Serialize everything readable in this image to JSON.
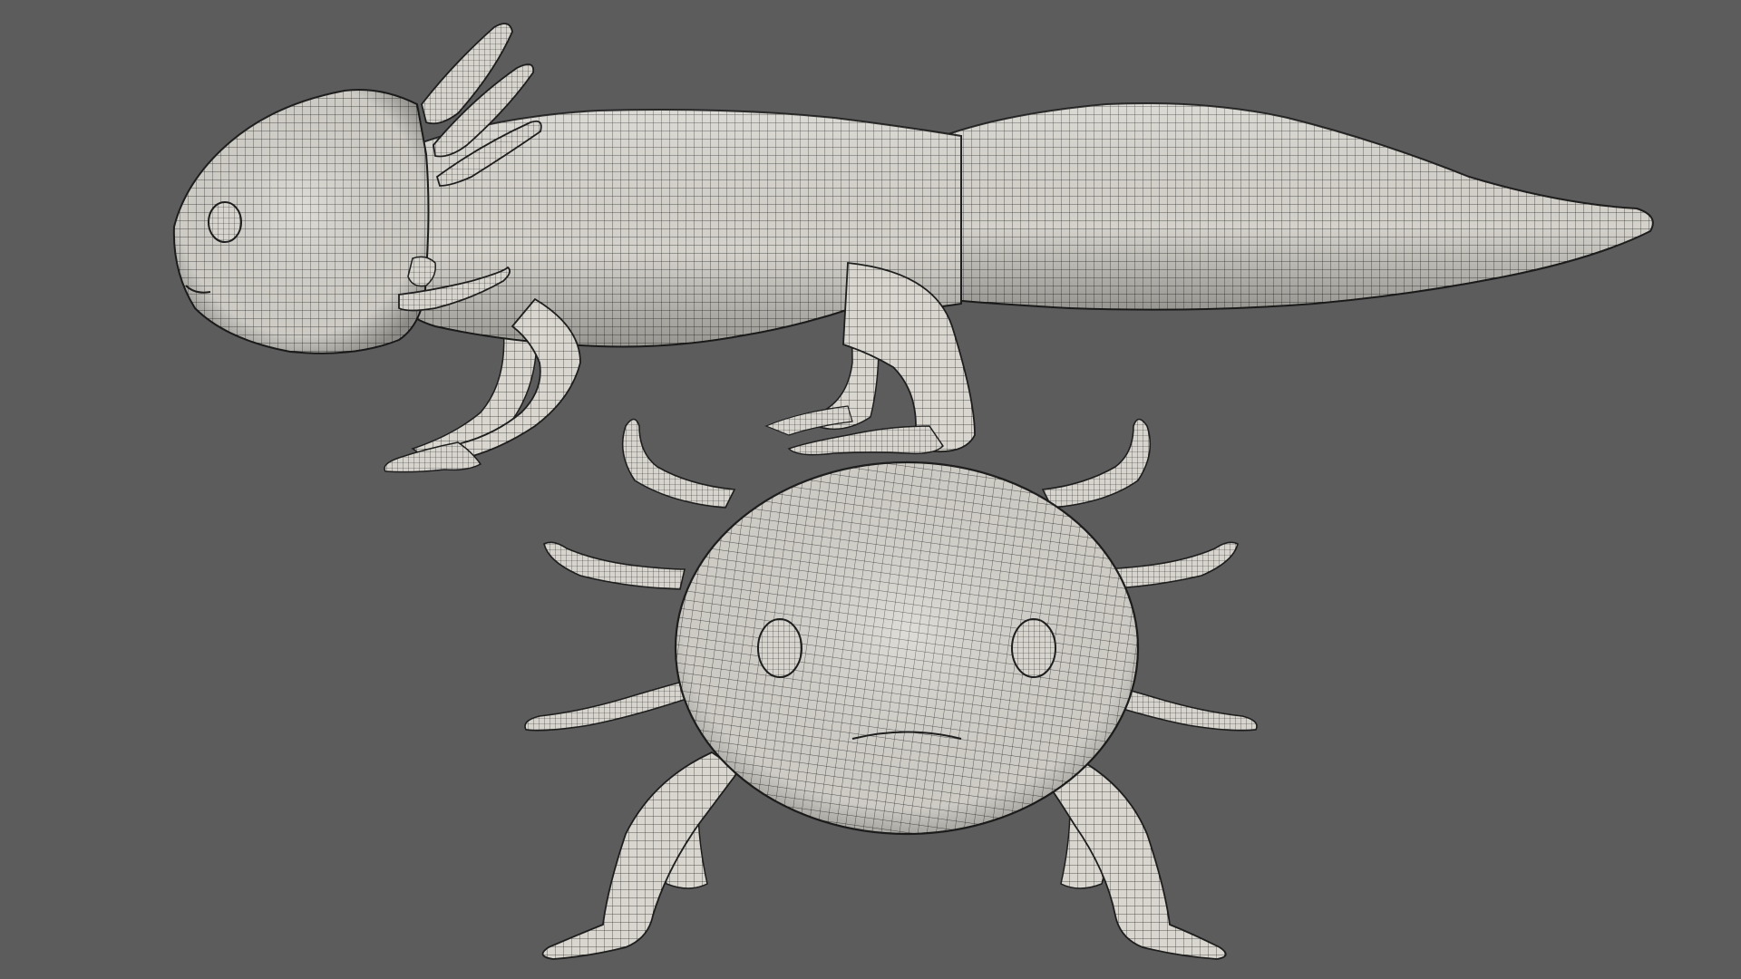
{
  "viewport": {
    "background_color": "#5c5c5c",
    "model_surface_color": "#d8d6cf",
    "wireframe_color": "#2b2b2b",
    "views": [
      {
        "id": "side",
        "subject": "axolotl"
      },
      {
        "id": "front",
        "subject": "axolotl"
      }
    ]
  }
}
